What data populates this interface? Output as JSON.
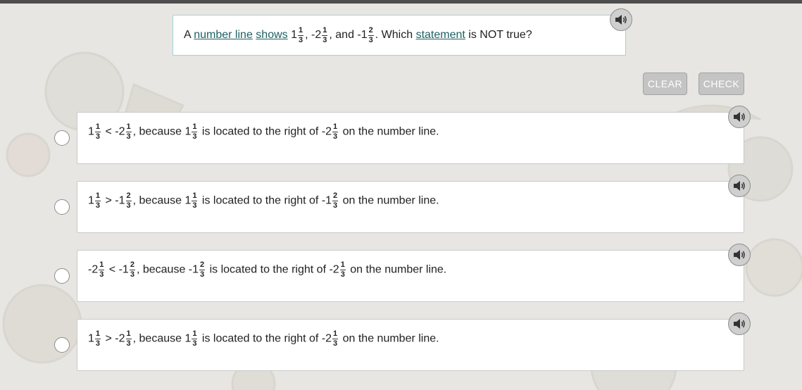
{
  "question": {
    "prefix": "A ",
    "link1": "number line",
    "link2": "shows",
    "n1_whole": "1",
    "n1_num": "1",
    "n1_den": "3",
    "n2_whole": "-2",
    "n2_num": "1",
    "n2_den": "3",
    "and_text": ", and ",
    "n3_whole": "-1",
    "n3_num": "2",
    "n3_den": "3",
    "mid_text": ". Which ",
    "link3": "statement",
    "suffix": " is NOT true?",
    "comma": ", "
  },
  "buttons": {
    "clear": "CLEAR",
    "check": "CHECK"
  },
  "options": [
    {
      "a_whole": "1",
      "a_num": "1",
      "a_den": "3",
      "op": " < ",
      "b_whole": "-2",
      "b_num": "1",
      "b_den": "3",
      "because": ", because ",
      "c_whole": "1",
      "c_num": "1",
      "c_den": "3",
      "located": " is located to the right of ",
      "d_whole": "-2",
      "d_num": "1",
      "d_den": "3",
      "end": " on the number line."
    },
    {
      "a_whole": "1",
      "a_num": "1",
      "a_den": "3",
      "op": " > ",
      "b_whole": "-1",
      "b_num": "2",
      "b_den": "3",
      "because": ", because ",
      "c_whole": "1",
      "c_num": "1",
      "c_den": "3",
      "located": " is located to the right of ",
      "d_whole": "-1",
      "d_num": "2",
      "d_den": "3",
      "end": " on the number line."
    },
    {
      "a_whole": "-2",
      "a_num": "1",
      "a_den": "3",
      "op": " < ",
      "b_whole": "-1",
      "b_num": "2",
      "b_den": "3",
      "because": ", because ",
      "c_whole": "-1",
      "c_num": "2",
      "c_den": "3",
      "located": " is located to the right of ",
      "d_whole": "-2",
      "d_num": "1",
      "d_den": "3",
      "end": " on the number line."
    },
    {
      "a_whole": "1",
      "a_num": "1",
      "a_den": "3",
      "op": " > ",
      "b_whole": "-2",
      "b_num": "1",
      "b_den": "3",
      "because": ", because ",
      "c_whole": "1",
      "c_num": "1",
      "c_den": "3",
      "located": " is located to the right of ",
      "d_whole": "-2",
      "d_num": "1",
      "d_den": "3",
      "end": " on the number line."
    }
  ],
  "icons": {
    "audio": "speaker-icon",
    "radio": "radio-circle"
  },
  "colors": {
    "background": "#e7e6e2",
    "topbar": "#4e4e4e",
    "question_border": "#9fd3d2",
    "link": "#1d5f63",
    "button": "#c4c4c4"
  }
}
